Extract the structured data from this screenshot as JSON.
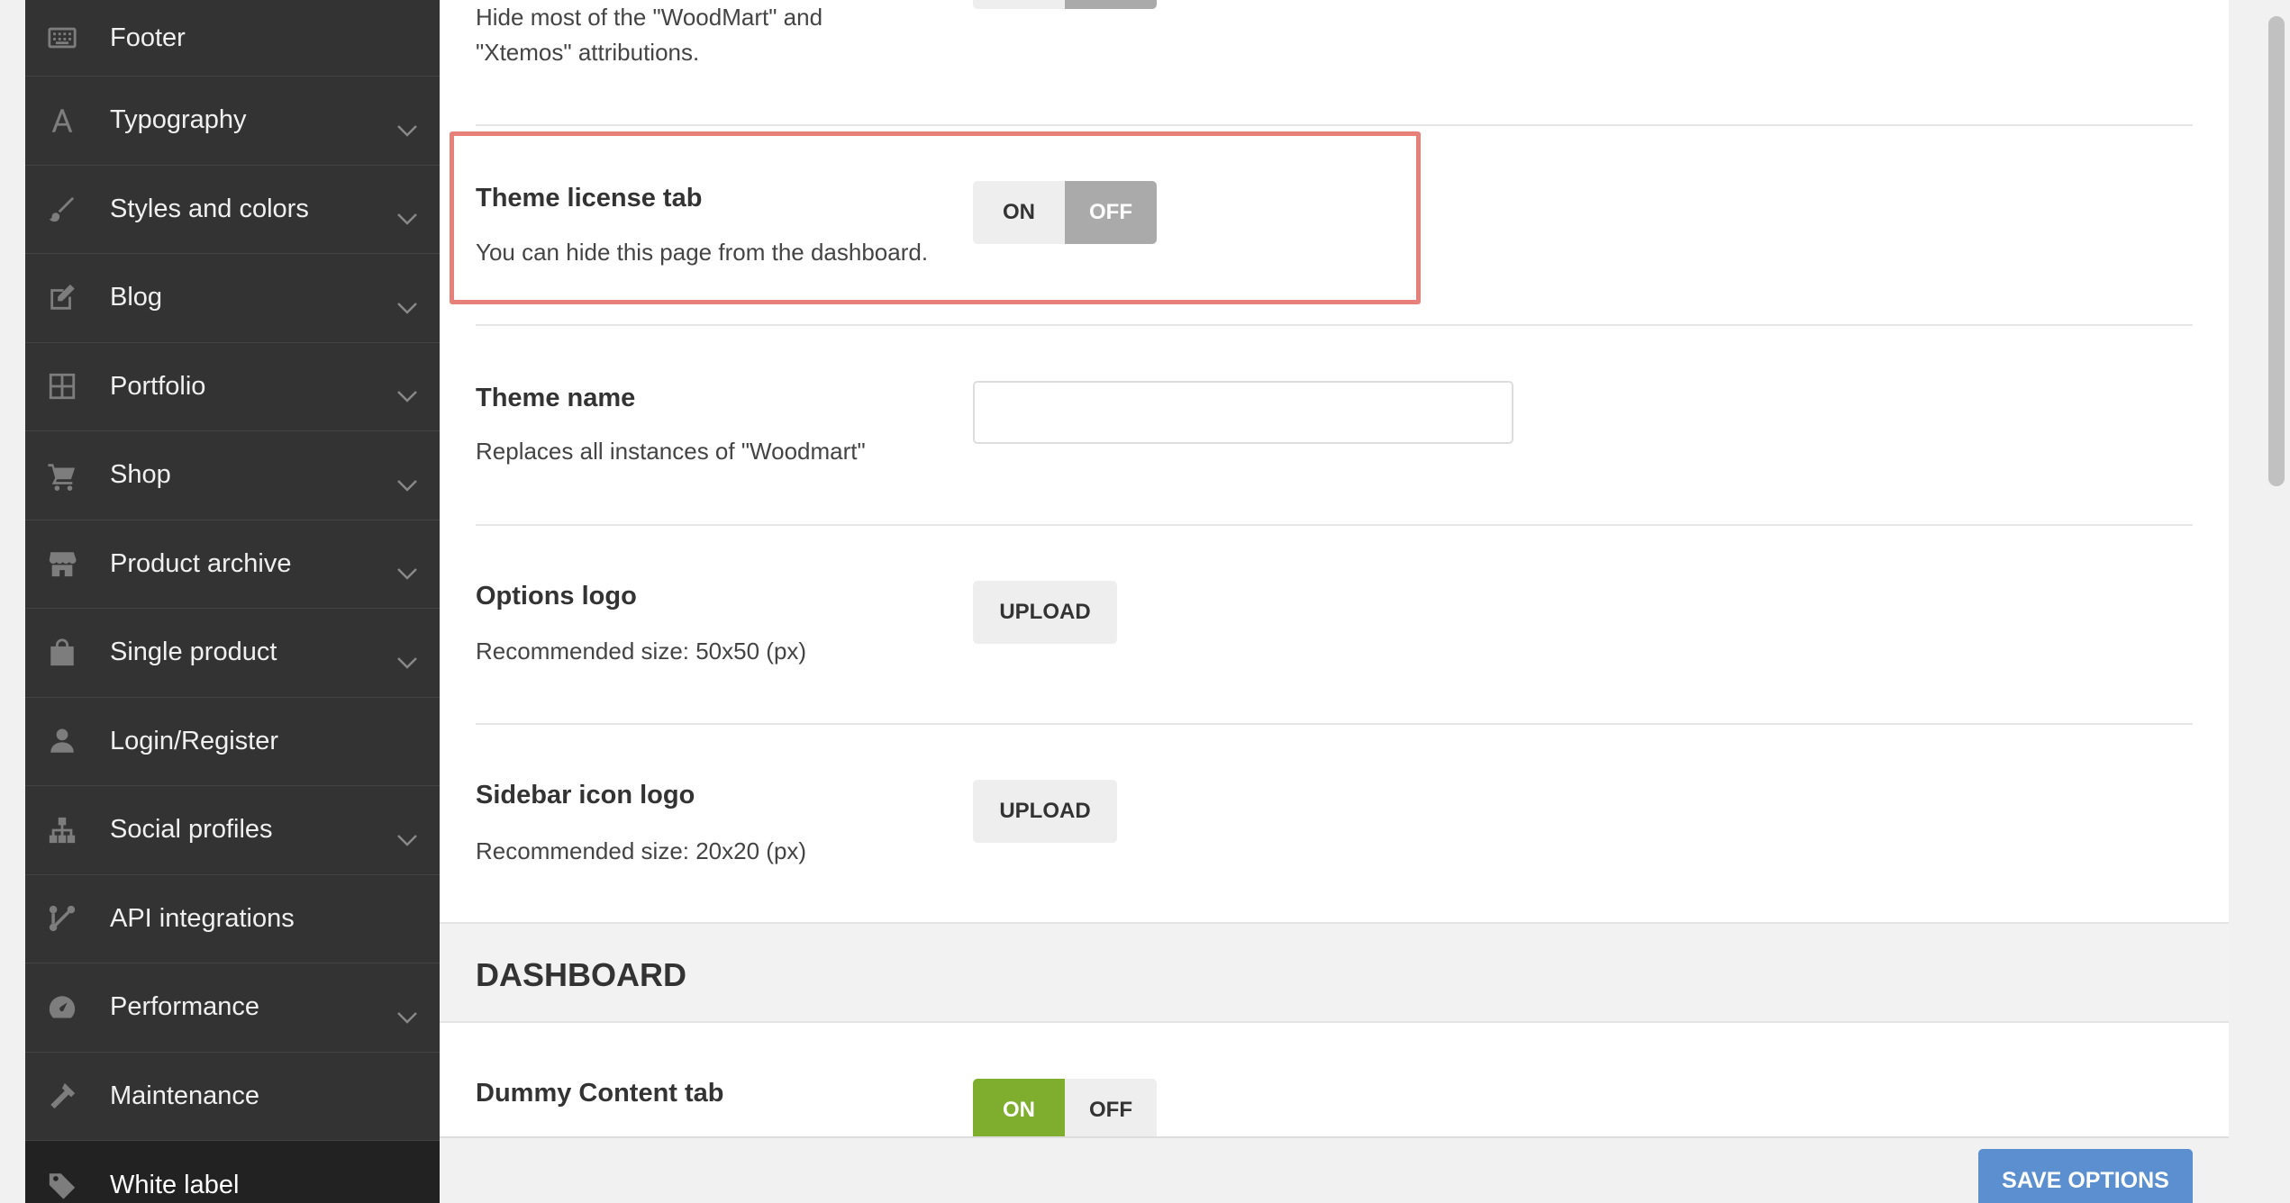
{
  "sidebar": {
    "items": [
      {
        "label": "Footer",
        "icon": "footer-icon",
        "has_chevron": false
      },
      {
        "label": "Typography",
        "icon": "typography-icon",
        "has_chevron": true
      },
      {
        "label": "Styles and colors",
        "icon": "brush-icon",
        "has_chevron": true
      },
      {
        "label": "Blog",
        "icon": "edit-icon",
        "has_chevron": true
      },
      {
        "label": "Portfolio",
        "icon": "grid-icon",
        "has_chevron": true
      },
      {
        "label": "Shop",
        "icon": "cart-icon",
        "has_chevron": true
      },
      {
        "label": "Product archive",
        "icon": "store-icon",
        "has_chevron": true
      },
      {
        "label": "Single product",
        "icon": "bag-icon",
        "has_chevron": true
      },
      {
        "label": "Login/Register",
        "icon": "user-icon",
        "has_chevron": false
      },
      {
        "label": "Social profiles",
        "icon": "sitemap-icon",
        "has_chevron": true
      },
      {
        "label": "API integrations",
        "icon": "connection-icon",
        "has_chevron": false
      },
      {
        "label": "Performance",
        "icon": "dashboard-icon",
        "has_chevron": true
      },
      {
        "label": "Maintenance",
        "icon": "hammer-icon",
        "has_chevron": false
      },
      {
        "label": "White label",
        "icon": "tag-icon",
        "has_chevron": false,
        "active": true
      }
    ]
  },
  "options": {
    "attributions_desc_line1": "Hide most of the \"WoodMart\" and",
    "attributions_desc_line2": "\"Xtemos\" attributions.",
    "license_tab": {
      "title": "Theme license tab",
      "desc": "You can hide this page from the dashboard.",
      "on_label": "ON",
      "off_label": "OFF",
      "value": "OFF"
    },
    "theme_name": {
      "title": "Theme name",
      "desc": "Replaces all instances of \"Woodmart\"",
      "value": ""
    },
    "options_logo": {
      "title": "Options logo",
      "desc": "Recommended size: 50x50 (px)",
      "button": "UPLOAD"
    },
    "sidebar_icon_logo": {
      "title": "Sidebar icon logo",
      "desc": "Recommended size: 20x20 (px)",
      "button": "UPLOAD"
    }
  },
  "dashboard": {
    "heading": "DASHBOARD",
    "dummy_content": {
      "title": "Dummy Content tab",
      "on_label": "ON",
      "off_label": "OFF",
      "value": "ON"
    }
  },
  "footer": {
    "save_label": "SAVE OPTIONS"
  },
  "colors": {
    "sidebar_bg": "#333333",
    "toggle_on": "#7fad2e",
    "toggle_off_active": "#aaaaaa",
    "save_button": "#5b8fcf",
    "highlight": "#e8807a"
  }
}
